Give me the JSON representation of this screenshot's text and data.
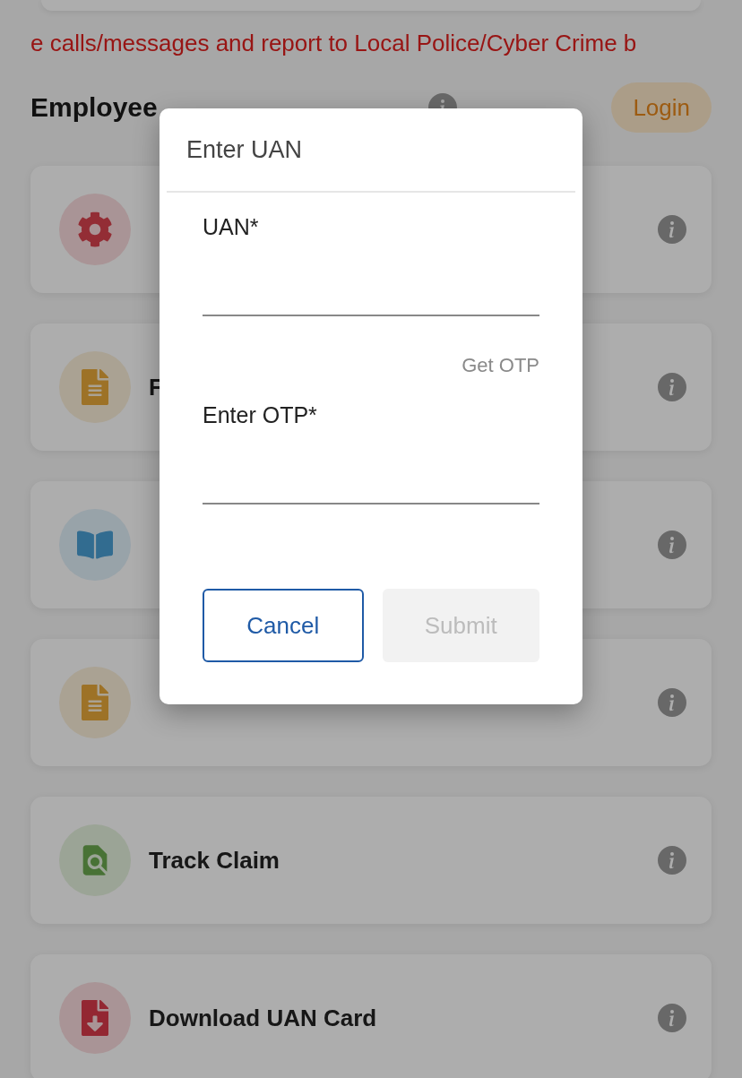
{
  "marquee": "e calls/messages and report to Local Police/Cyber Crime b",
  "section": {
    "title": "Employee",
    "login_button": "Login"
  },
  "services": [
    {
      "kind": "gear"
    },
    {
      "title": "F",
      "kind": "document-alert"
    },
    {
      "kind": "book"
    },
    {
      "kind": "document-alert"
    },
    {
      "title": "Track Claim",
      "kind": "document-search"
    },
    {
      "title": "Download UAN Card",
      "kind": "document-download"
    }
  ],
  "dialog": {
    "title": "Enter UAN",
    "fields": [
      {
        "label": "UAN*",
        "action": "Get OTP"
      },
      {
        "label": "Enter OTP*"
      }
    ],
    "buttons": [
      {
        "label": "Cancel",
        "disabled": false
      },
      {
        "label": "Submit",
        "disabled": true
      }
    ]
  }
}
